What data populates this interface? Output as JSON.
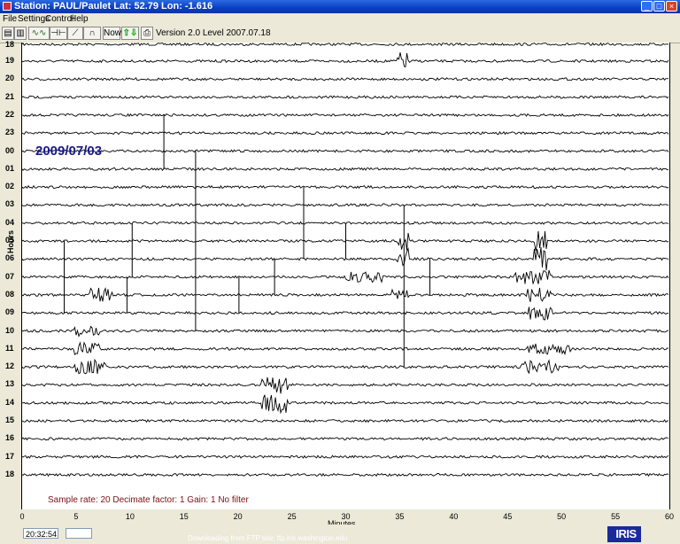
{
  "window": {
    "title": "Station: PAUL/Paulet Lat: 52.79 Lon: -1.616",
    "minimize_label": "_",
    "maximize_label": "□",
    "close_label": "×"
  },
  "menu": [
    "File",
    "Settings",
    "Control",
    "Help"
  ],
  "toolbar": {
    "now_label": "Now",
    "version_text": "Version 2.0 Level 2007.07.18"
  },
  "plot": {
    "date_label": "2009/07/03",
    "y_axis_title": "Hours",
    "x_axis_title": "Minutes",
    "hour_labels": [
      "19",
      "20",
      "21",
      "22",
      "23",
      "00",
      "01",
      "02",
      "03",
      "04",
      "05",
      "06",
      "07",
      "08",
      "09",
      "10",
      "11",
      "12",
      "13",
      "14",
      "15",
      "16",
      "17",
      "18"
    ],
    "top_partial_label": "18",
    "x_ticks": [
      "0",
      "5",
      "10",
      "15",
      "20",
      "25",
      "30",
      "35",
      "40",
      "45",
      "50",
      "55",
      "60"
    ],
    "params": "Sample rate: 20   Decimate factor: 1   Gain: 1   No filter"
  },
  "status": {
    "time": "20:32:54",
    "download_text": "Downloading from FTP site: ftp.iris.washington.edu",
    "logo": "IRIS"
  },
  "colors": {
    "title_bar": "#0a3fc2",
    "date_label": "#1a1a8c",
    "params": "#7a1010",
    "trace": "#000000"
  }
}
